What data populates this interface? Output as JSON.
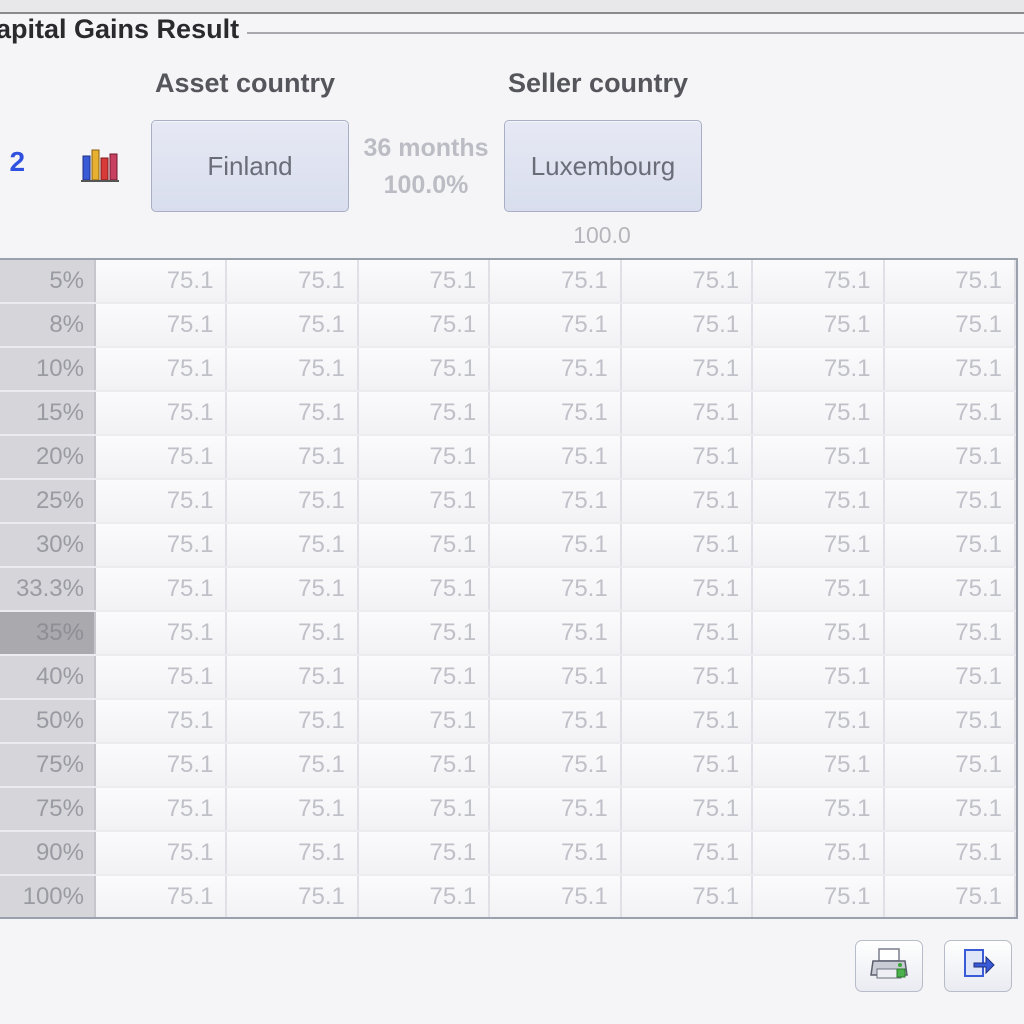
{
  "group_title": "apital Gains Result",
  "headers": {
    "asset_country": "Asset country",
    "seller_country": "Seller country"
  },
  "scenario_label": ". 2",
  "asset_country": "Finland",
  "seller_country": "Luxembourg",
  "holding_period": "36 months",
  "holding_percent": "100.0%",
  "seller_percent": "100.0",
  "grid": {
    "selected_row_index": 8,
    "rows": [
      {
        "label": "5%",
        "values": [
          "75.1",
          "75.1",
          "75.1",
          "75.1",
          "75.1",
          "75.1",
          "75.1"
        ]
      },
      {
        "label": "8%",
        "values": [
          "75.1",
          "75.1",
          "75.1",
          "75.1",
          "75.1",
          "75.1",
          "75.1"
        ]
      },
      {
        "label": "10%",
        "values": [
          "75.1",
          "75.1",
          "75.1",
          "75.1",
          "75.1",
          "75.1",
          "75.1"
        ]
      },
      {
        "label": "15%",
        "values": [
          "75.1",
          "75.1",
          "75.1",
          "75.1",
          "75.1",
          "75.1",
          "75.1"
        ]
      },
      {
        "label": "20%",
        "values": [
          "75.1",
          "75.1",
          "75.1",
          "75.1",
          "75.1",
          "75.1",
          "75.1"
        ]
      },
      {
        "label": "25%",
        "values": [
          "75.1",
          "75.1",
          "75.1",
          "75.1",
          "75.1",
          "75.1",
          "75.1"
        ]
      },
      {
        "label": "30%",
        "values": [
          "75.1",
          "75.1",
          "75.1",
          "75.1",
          "75.1",
          "75.1",
          "75.1"
        ]
      },
      {
        "label": "33.3%",
        "values": [
          "75.1",
          "75.1",
          "75.1",
          "75.1",
          "75.1",
          "75.1",
          "75.1"
        ]
      },
      {
        "label": "35%",
        "values": [
          "75.1",
          "75.1",
          "75.1",
          "75.1",
          "75.1",
          "75.1",
          "75.1"
        ]
      },
      {
        "label": "40%",
        "values": [
          "75.1",
          "75.1",
          "75.1",
          "75.1",
          "75.1",
          "75.1",
          "75.1"
        ]
      },
      {
        "label": "50%",
        "values": [
          "75.1",
          "75.1",
          "75.1",
          "75.1",
          "75.1",
          "75.1",
          "75.1"
        ]
      },
      {
        "label": "75%",
        "values": [
          "75.1",
          "75.1",
          "75.1",
          "75.1",
          "75.1",
          "75.1",
          "75.1"
        ]
      },
      {
        "label": "75%",
        "values": [
          "75.1",
          "75.1",
          "75.1",
          "75.1",
          "75.1",
          "75.1",
          "75.1"
        ]
      },
      {
        "label": "90%",
        "values": [
          "75.1",
          "75.1",
          "75.1",
          "75.1",
          "75.1",
          "75.1",
          "75.1"
        ]
      },
      {
        "label": "100%",
        "values": [
          "75.1",
          "75.1",
          "75.1",
          "75.1",
          "75.1",
          "75.1",
          "75.1"
        ]
      }
    ]
  },
  "icons": {
    "chart": "bar-chart-icon",
    "print": "printer-icon",
    "export": "export-icon"
  },
  "colors": {
    "scenario_link": "#3050e0",
    "button_fill": "#dfe3f0",
    "selected_row": "#a9a9ae"
  }
}
